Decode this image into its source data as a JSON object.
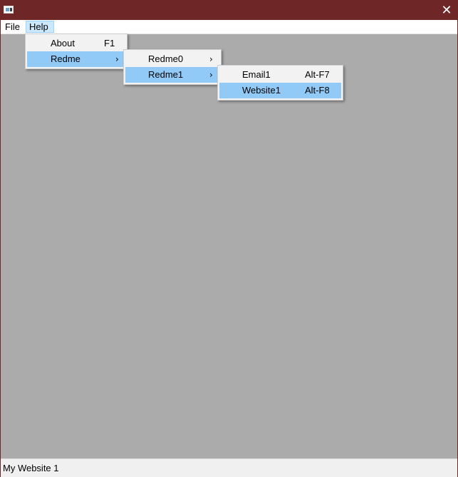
{
  "window": {
    "close_glyph": "✕"
  },
  "menubar": {
    "file_label": "File",
    "help_label": "Help"
  },
  "help_menu": {
    "items": [
      {
        "label": "About",
        "shortcut": "F1"
      },
      {
        "label": "Redme",
        "arrow": "›"
      }
    ]
  },
  "redme_menu": {
    "items": [
      {
        "label": "Redme0",
        "arrow": "›"
      },
      {
        "label": "Redme1",
        "arrow": "›"
      }
    ]
  },
  "redme1_menu": {
    "items": [
      {
        "label": "Email1",
        "shortcut": "Alt-F7"
      },
      {
        "label": "Website1",
        "shortcut": "Alt-F8"
      }
    ]
  },
  "statusbar": {
    "text": "My Website 1"
  },
  "colors": {
    "titlebar": "#6e2626",
    "highlight": "#91c9f7",
    "client": "#ababab"
  }
}
